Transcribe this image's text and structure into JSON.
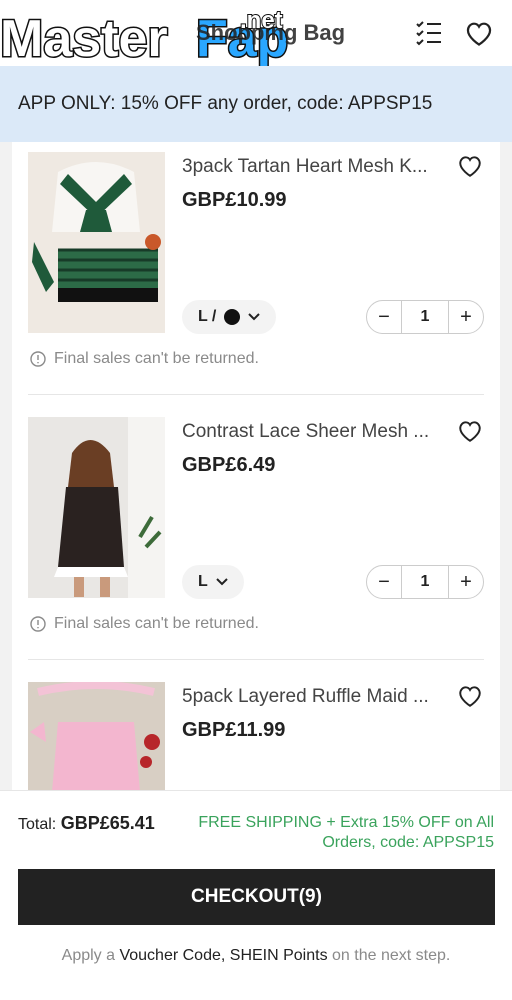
{
  "watermark": {
    "text": "MasterFap",
    "suffix": ".net"
  },
  "header": {
    "title": "Shopping Bag"
  },
  "promo": {
    "text": "APP ONLY: 15% OFF any order, code: APPSP15"
  },
  "items": [
    {
      "name": "3pack Tartan Heart Mesh K...",
      "price": "GBP£10.99",
      "variant": "L /",
      "qty": "1",
      "note": "Final sales can't be returned."
    },
    {
      "name": "Contrast Lace Sheer Mesh ...",
      "price": "GBP£6.49",
      "variant": "L",
      "qty": "1",
      "note": "Final sales can't be returned."
    },
    {
      "name": "5pack Layered Ruffle Maid ...",
      "price": "GBP£11.99"
    }
  ],
  "footer": {
    "total_label": "Total:",
    "total_amount": "GBP£65.41",
    "shipping_line1": "FREE SHIPPING + Extra 15% OFF on All",
    "shipping_line2": "Orders, code: APPSP15",
    "checkout_label": "CHECKOUT(9)",
    "apply_prefix": "Apply a ",
    "apply_highlight": "Voucher Code, SHEIN Points",
    "apply_suffix": " on the next step."
  },
  "icons": {
    "checklist": "checklist-icon",
    "wishlist": "heart-icon",
    "info": "info-icon",
    "chevron": "chevron-down-icon"
  },
  "colors": {
    "promo_bg": "#dbe9f8",
    "shipping_text": "#3aa35c",
    "checkout_bg": "#222222"
  }
}
